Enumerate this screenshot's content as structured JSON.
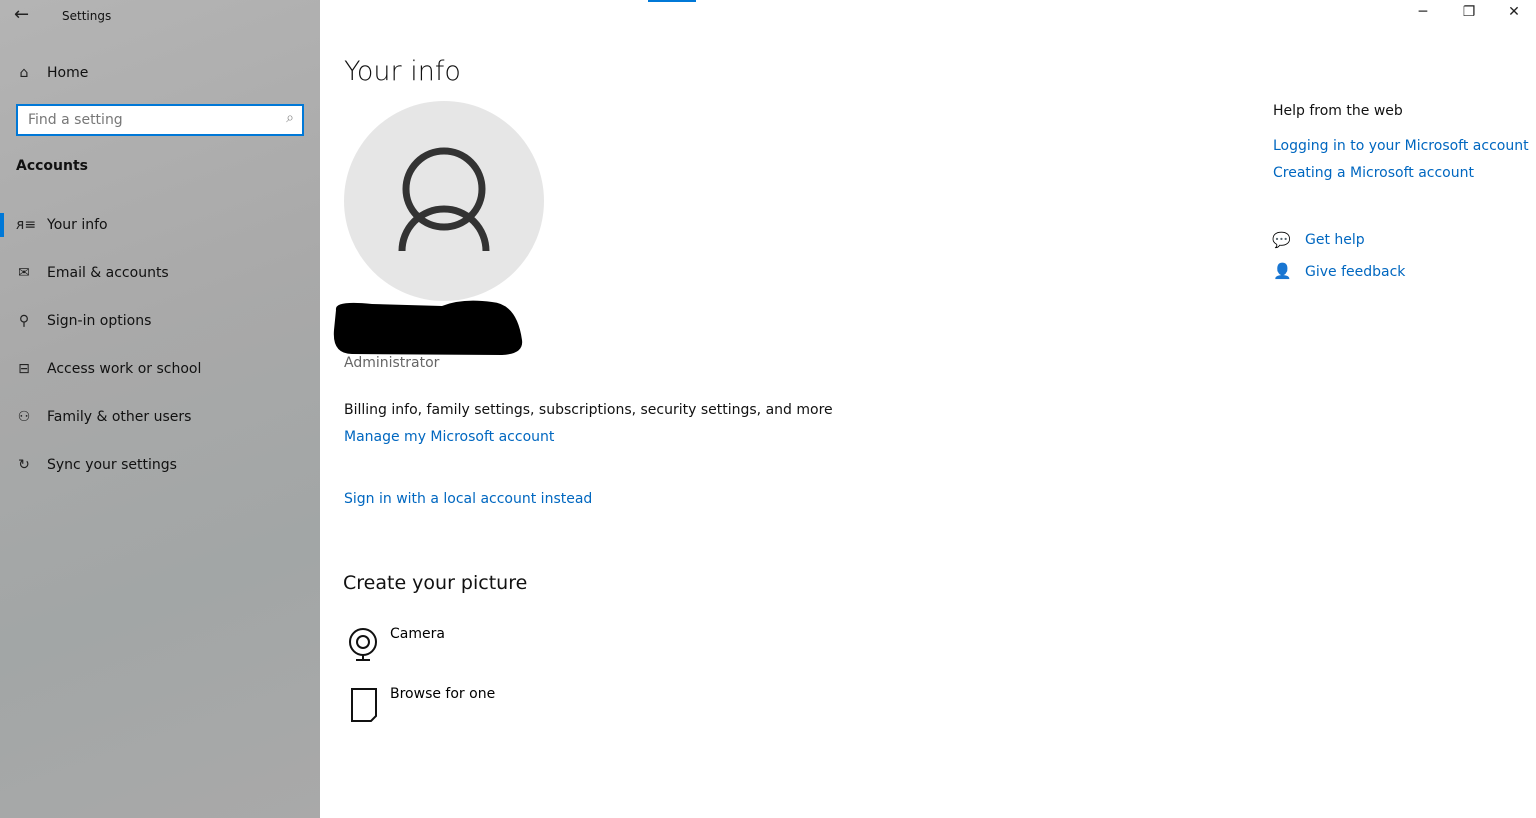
{
  "window": {
    "title": "Settings",
    "minimize": "─",
    "restore": "❐",
    "close": "✕"
  },
  "sidebar": {
    "home": "Home",
    "search_placeholder": "Find a setting",
    "section": "Accounts",
    "items": [
      {
        "label": "Your info",
        "icon": "person-list-icon",
        "glyph": "ᴙ≡",
        "selected": true
      },
      {
        "label": "Email & accounts",
        "icon": "mail-icon",
        "glyph": "✉"
      },
      {
        "label": "Sign-in options",
        "icon": "key-icon",
        "glyph": "⚲"
      },
      {
        "label": "Access work or school",
        "icon": "briefcase-icon",
        "glyph": "⊟"
      },
      {
        "label": "Family & other users",
        "icon": "person-add-icon",
        "glyph": "⚇"
      },
      {
        "label": "Sync your settings",
        "icon": "sync-icon",
        "glyph": "↻"
      }
    ]
  },
  "main": {
    "title": "Your info",
    "role": "Administrator",
    "billing_text": "Billing info, family settings, subscriptions, security settings, and more",
    "manage_link": "Manage my Microsoft account",
    "local_link": "Sign in with a local account instead",
    "picture_heading": "Create your picture",
    "camera": "Camera",
    "browse": "Browse for one"
  },
  "help": {
    "heading": "Help from the web",
    "links": [
      "Logging in to your Microsoft account",
      "Creating a Microsoft account"
    ],
    "get_help": "Get help",
    "give_feedback": "Give feedback"
  },
  "colors": {
    "accent": "#0078d7",
    "link": "#0067c0"
  }
}
